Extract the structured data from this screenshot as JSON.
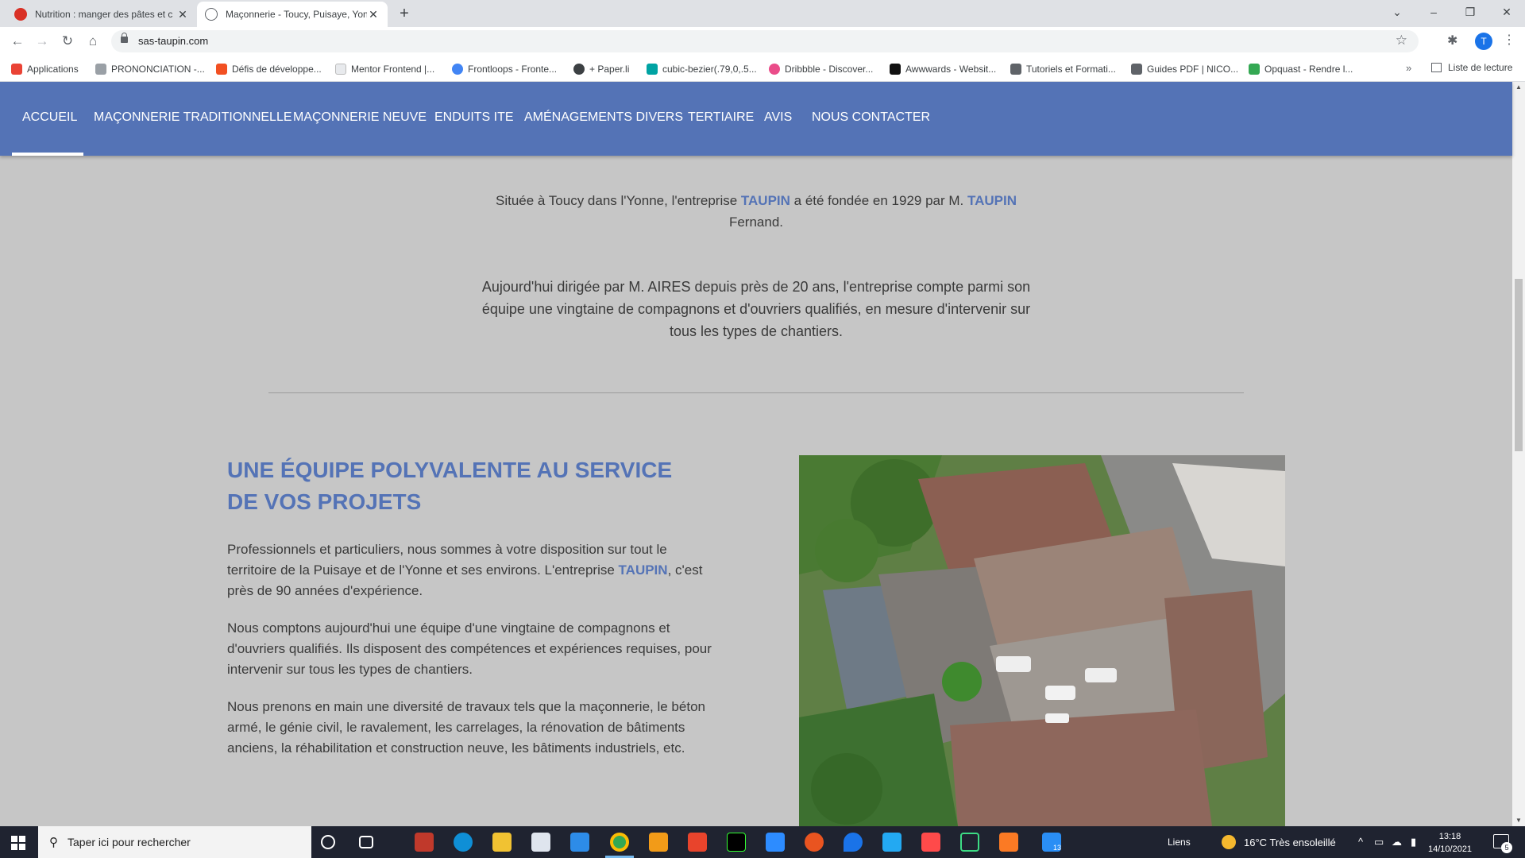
{
  "browser": {
    "tabs": [
      {
        "title": "Nutrition : manger des pâtes et c",
        "active": false
      },
      {
        "title": "Maçonnerie - Toucy, Puisaye, Yon",
        "active": true
      }
    ],
    "new_tab": "+",
    "address": "sas-taupin.com",
    "avatar_letter": "T",
    "bookmarks": [
      {
        "label": "Applications",
        "color": "#ea4335"
      },
      {
        "label": "PRONONCIATION -...",
        "color": "#9aa0a6"
      },
      {
        "label": "Défis de développe...",
        "color": "#f25022"
      },
      {
        "label": "Mentor Frontend |...",
        "color": "#e8eaed"
      },
      {
        "label": "Frontloops - Fronte...",
        "color": "#4285f4"
      },
      {
        "label": "+ Paper.li",
        "color": "#3c4043"
      },
      {
        "label": "cubic-bezier(.79,0,.5...",
        "color": "#00a3a3"
      },
      {
        "label": "Dribbble - Discover...",
        "color": "#ea4c89"
      },
      {
        "label": "Awwwards - Websit...",
        "color": "#111111"
      },
      {
        "label": "Tutoriels et Formati...",
        "color": "#5f6368"
      },
      {
        "label": "Guides PDF | NICO...",
        "color": "#5f6368"
      },
      {
        "label": "Opquast - Rendre l...",
        "color": "#34a853"
      }
    ],
    "more_bookmarks": "»",
    "reading_list": "Liste de lecture"
  },
  "site": {
    "accent_color": "#5473b6",
    "nav": [
      {
        "label": "ACCUEIL",
        "active": true
      },
      {
        "label": "MAÇONNERIE TRADITIONNELLE"
      },
      {
        "label": "MAÇONNERIE NEUVE"
      },
      {
        "label": "ENDUITS ITE"
      },
      {
        "label": "AMÉNAGEMENTS DIVERS"
      },
      {
        "label": "TERTIAIRE"
      },
      {
        "label": "AVIS"
      },
      {
        "label": "NOUS CONTACTER"
      }
    ],
    "intro1": {
      "part1": "Située à Toucy dans l'Yonne, l'entreprise ",
      "name1": "TAUPIN",
      "part2": " a été fondée en 1929 par M. ",
      "name2": "TAUPIN",
      "part3": " Fernand."
    },
    "intro2": "Aujourd'hui dirigée par M. AIRES depuis près de 20 ans, l'entreprise compte parmi son équipe une vingtaine de compagnons et d'ouvriers qualifiés, en mesure d'intervenir sur tous les types de chantiers.",
    "section_title": "UNE ÉQUIPE POLYVALENTE AU SERVICE DE VOS PROJETS",
    "para1": {
      "part1": "Professionnels et particuliers, nous sommes à votre disposition sur tout le territoire de la Puisaye et de l'Yonne et ses environs. L'entreprise ",
      "name": "TAUPIN",
      "part2": ", c'est près de 90 années d'expérience."
    },
    "para2": "Nous comptons aujourd'hui une équipe d'une vingtaine de compagnons et d'ouvriers qualifiés. Ils disposent des compétences et expériences requises, pour intervenir sur tous les types de chantiers.",
    "para3": "Nous prenons en main une diversité de travaux tels que la maçonnerie, le béton armé, le génie civil, le ravalement, les carrelages, la rénovation de bâtiments anciens, la réhabilitation et construction neuve, les bâtiments industriels, etc.",
    "photo_icon": "aerial-photo-of-buildings"
  },
  "taskbar": {
    "search_placeholder": "Taper ici pour rechercher",
    "liens": "Liens",
    "temperature": "16°C",
    "weather": "Très ensoleillé",
    "time": "13:18",
    "date": "14/10/2021",
    "notification_count": "5",
    "taskbar_badge": "13"
  }
}
